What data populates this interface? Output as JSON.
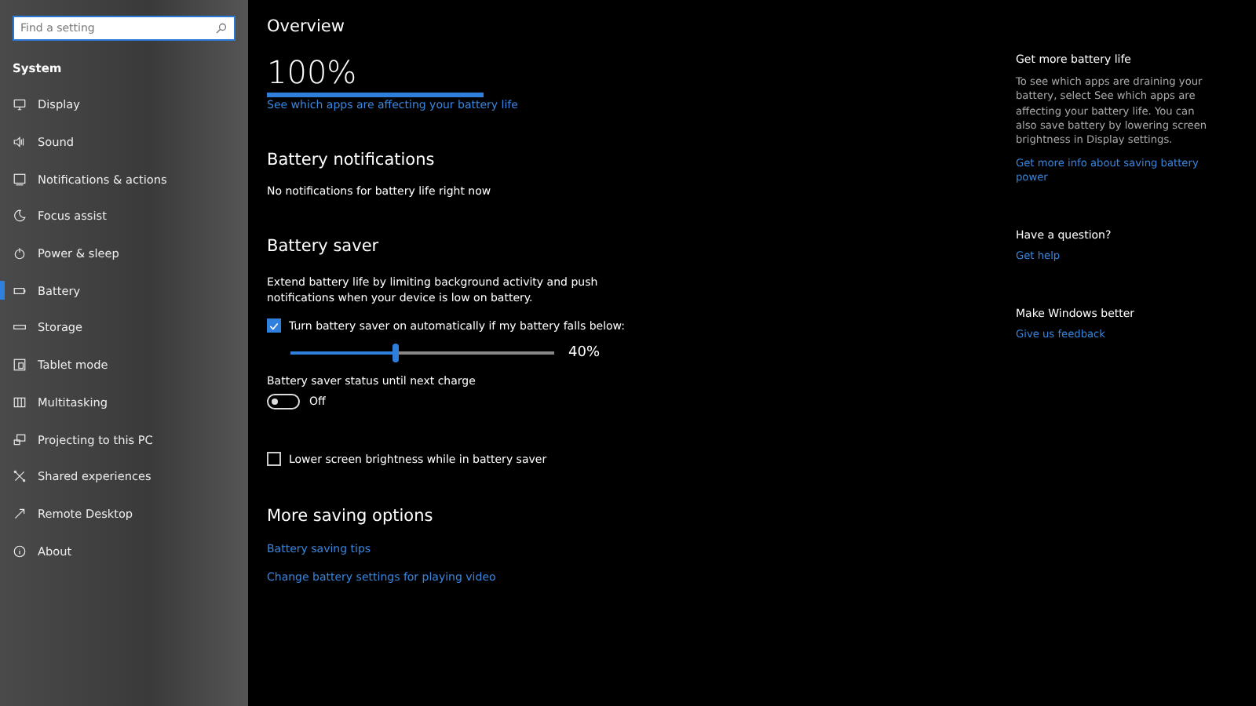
{
  "search": {
    "placeholder": "Find a setting"
  },
  "sidebar": {
    "heading": "System",
    "items": [
      {
        "label": "Display",
        "selected": false
      },
      {
        "label": "Sound",
        "selected": false
      },
      {
        "label": "Notifications & actions",
        "selected": false
      },
      {
        "label": "Focus assist",
        "selected": false
      },
      {
        "label": "Power & sleep",
        "selected": false
      },
      {
        "label": "Battery",
        "selected": true
      },
      {
        "label": "Storage",
        "selected": false
      },
      {
        "label": "Tablet mode",
        "selected": false
      },
      {
        "label": "Multitasking",
        "selected": false
      },
      {
        "label": "Projecting to this PC",
        "selected": false
      },
      {
        "label": "Shared experiences",
        "selected": false
      },
      {
        "label": "Remote Desktop",
        "selected": false
      },
      {
        "label": "About",
        "selected": false
      }
    ]
  },
  "overview": {
    "heading": "Overview",
    "percent": "100%",
    "level": 1,
    "link": "See which apps are affecting your battery life"
  },
  "notifications": {
    "heading": "Battery notifications",
    "text": "No notifications for battery life right now"
  },
  "saver": {
    "heading": "Battery saver",
    "description": "Extend battery life by limiting background activity and push notifications when your device is low on battery.",
    "auto": {
      "label": "Turn battery saver on automatically if my battery falls below:",
      "checked": true
    },
    "slider": {
      "level": 0.4,
      "reading": "40%"
    },
    "status": {
      "label": "Battery saver status until next charge",
      "on": false,
      "state": "Off"
    },
    "brightness": {
      "label": "Lower screen brightness while in battery saver",
      "checked": false
    }
  },
  "more": {
    "heading": "More saving options",
    "links": [
      "Battery saving tips",
      "Change battery settings for playing video"
    ]
  },
  "aside": [
    {
      "heading": "Get more battery life",
      "text": "To see which apps are draining your battery, select See which apps are affecting your battery life. You can also save battery by lowering screen brightness in Display settings.",
      "link": "Get more info about saving battery power"
    },
    {
      "heading": "Have a question?",
      "link": "Get help"
    },
    {
      "heading": "Make Windows better",
      "link": "Give us feedback"
    }
  ]
}
